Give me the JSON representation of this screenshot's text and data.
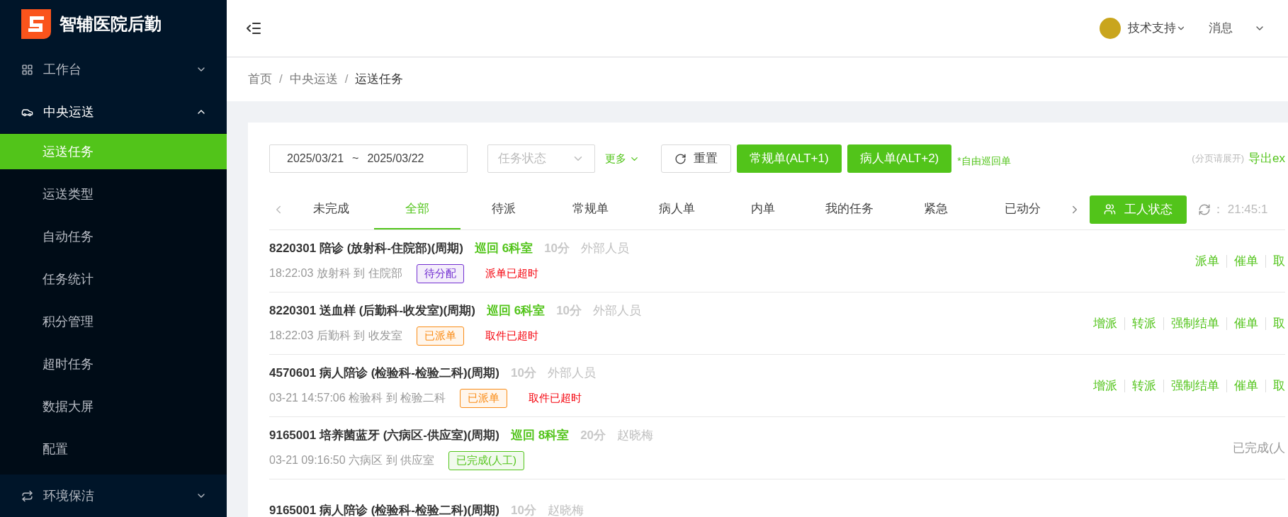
{
  "brand": {
    "name": "智辅医院后勤"
  },
  "sidebar": {
    "items": [
      {
        "label": "工作台",
        "expanded": false
      },
      {
        "label": "中央运送",
        "expanded": true,
        "children": [
          {
            "label": "运送任务",
            "selected": true
          },
          {
            "label": "运送类型",
            "selected": false
          },
          {
            "label": "自动任务",
            "selected": false
          },
          {
            "label": "任务统计",
            "selected": false
          },
          {
            "label": "积分管理",
            "selected": false
          },
          {
            "label": "超时任务",
            "selected": false
          },
          {
            "label": "数据大屏",
            "selected": false
          },
          {
            "label": "配置",
            "selected": false
          }
        ]
      },
      {
        "label": "环境保洁",
        "expanded": false
      }
    ]
  },
  "header": {
    "user": "技术支持",
    "messages": "消息"
  },
  "breadcrumb": {
    "separator": "/",
    "items": [
      "首页",
      "中央运送",
      "运送任务"
    ]
  },
  "filters": {
    "date_start": "2025/03/21",
    "date_sep": "~",
    "date_end": "2025/03/22",
    "status_placeholder": "任务状态",
    "more": "更多",
    "reset": "重置",
    "buttons": [
      "常规单(ALT+1)",
      "病人单(ALT+2)"
    ],
    "free_patrol": "*自由巡回单",
    "export_hint": "(分页请展开)",
    "export": "导出ex"
  },
  "tabs": [
    {
      "label": "未完成",
      "selected": false
    },
    {
      "label": "全部",
      "selected": true
    },
    {
      "label": "待派",
      "selected": false
    },
    {
      "label": "常规单",
      "selected": false
    },
    {
      "label": "病人单",
      "selected": false
    },
    {
      "label": "内单",
      "selected": false
    },
    {
      "label": "我的任务",
      "selected": false
    },
    {
      "label": "紧急",
      "selected": false
    },
    {
      "label": "已动分",
      "selected": false
    }
  ],
  "worker_status": "工人状态",
  "refresh_time": "： 21:45:1",
  "tasks": [
    {
      "title": "8220301 陪诊 (放射科-住院部)(周期)",
      "patrol": "巡回 6科室",
      "duration": "10分",
      "person": "外部人员",
      "route": "18:22:03 放射科 到 住院部",
      "status": "待分配",
      "color": "#722ed1",
      "timeout": "派单已超时",
      "actions": [
        "派单",
        "催单",
        "取"
      ]
    },
    {
      "title": "8220301 送血样 (后勤科-收发室)(周期)",
      "patrol": "巡回 6科室",
      "duration": "10分",
      "person": "外部人员",
      "route": "18:22:03 后勤科 到 收发室",
      "status": "已派单",
      "color": "#fa8c16",
      "timeout": "取件已超时",
      "actions": [
        "增派",
        "转派",
        "强制结单",
        "催单",
        "取"
      ]
    },
    {
      "title": "4570601 病人陪诊 (检验科-检验二科)(周期)",
      "duration": "10分",
      "person": "外部人员",
      "route": "03-21 14:57:06 检验科 到 检验二科",
      "status": "已派单",
      "color": "#fa8c16",
      "timeout": "取件已超时",
      "actions": [
        "增派",
        "转派",
        "强制结单",
        "催单",
        "取"
      ]
    },
    {
      "title": "9165001 培养菌蓝牙 (六病区-供应室)(周期)",
      "patrol": "巡回 8科室",
      "duration": "20分",
      "person": "赵晓梅",
      "route": "03-21 09:16:50 六病区 到 供应室",
      "status": "已完成(人工)",
      "color": "#52c41a",
      "result": "已完成(人"
    },
    {
      "title": "9165001 病人陪诊 (检验科-检验二科)(周期)",
      "duration": "10分",
      "person": "赵晓梅"
    }
  ]
}
